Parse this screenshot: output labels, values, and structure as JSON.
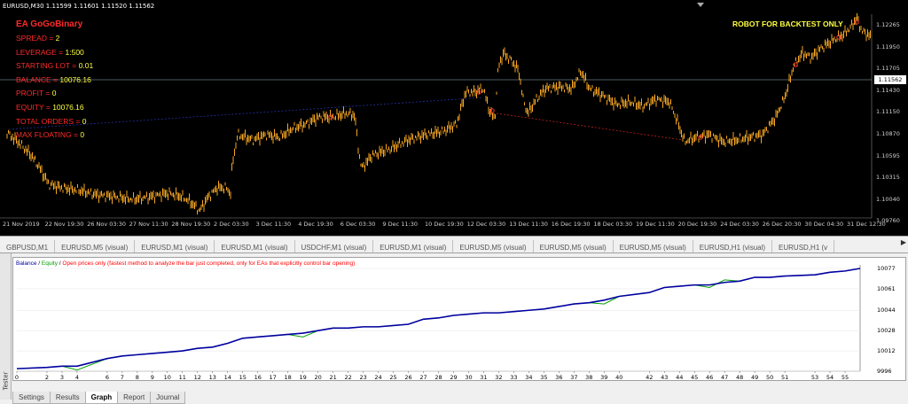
{
  "chart": {
    "title": "EURUSD,M30  1.11599 1.11601 1.11520 1.11562",
    "ea_name": "EA GoGoBinary",
    "stats": [
      {
        "label": "SPREAD = ",
        "value": "2"
      },
      {
        "label": "LEVERAGE = ",
        "value": "1:500"
      },
      {
        "label": "STARTING LOT = ",
        "value": "0.01"
      },
      {
        "label": "BALANCE = ",
        "value": "10076.16"
      },
      {
        "label": "PROFIT = ",
        "value": "0"
      },
      {
        "label": "EQUITY = ",
        "value": "10076.16"
      },
      {
        "label": "TOTAL ORDERS = ",
        "value": "0"
      },
      {
        "label": "MAX FLOATING = ",
        "value": "0"
      }
    ],
    "robot_label": "ROBOT FOR BACKTEST ONLY",
    "price_ticks": [
      "1.12265",
      "1.11950",
      "1.11705",
      "1.11430",
      "1.11150",
      "1.10870",
      "1.10595",
      "1.10315",
      "1.10040",
      "1.09760"
    ],
    "current_price": "1.11562",
    "time_ticks": [
      "21 Nov 2019",
      "22 Nov 19:30",
      "26 Nov 03:30",
      "27 Nov 11:30",
      "28 Nov 19:30",
      "2 Dec 03:30",
      "3 Dec 11:30",
      "4 Dec 19:30",
      "6 Dec 03:30",
      "9 Dec 11:30",
      "10 Dec 19:30",
      "12 Dec 03:30",
      "13 Dec 11:30",
      "16 Dec 19:30",
      "18 Dec 03:30",
      "19 Dec 11:30",
      "20 Dec 19:30",
      "24 Dec 03:30",
      "26 Dec 20:30",
      "30 Dec 04:30",
      "31 Dec 12:30"
    ],
    "colors": {
      "background": "#000000",
      "candle": "#f5a623",
      "label_red": "#ff2a2a",
      "label_yellow": "#ffff40"
    }
  },
  "chart_tabs": [
    "GBPUSD,M1",
    "EURUSD,M5 (visual)",
    "EURUSD,M1 (visual)",
    "EURUSD,M1 (visual)",
    "USDCHF,M1 (visual)",
    "EURUSD,M1 (visual)",
    "EURUSD,M5 (visual)",
    "EURUSD,M5 (visual)",
    "EURUSD,M5 (visual)",
    "EURUSD,H1 (visual)",
    "EURUSD,H1 (v"
  ],
  "tester": {
    "side_label": "Tester",
    "legend": {
      "balance": "Balance",
      "sep1": " / ",
      "equity": "Equity",
      "sep2": " / ",
      "mode": "Open prices only (fastest method to analyze the bar just completed, only for EAs that explicitly control bar opening)"
    },
    "tabs": [
      "Settings",
      "Results",
      "Graph",
      "Report",
      "Journal"
    ],
    "active_tab": "Graph",
    "colors": {
      "balance": "#0000a0",
      "equity": "#00a000",
      "mode": "#ff0000"
    }
  },
  "chart_data": {
    "type": "line",
    "ylim": [
      9996,
      10077
    ],
    "y_ticks": [
      "10077",
      "10061",
      "10044",
      "10028",
      "10012",
      "9996"
    ],
    "x_ticks": [
      "0",
      "2",
      "3",
      "4",
      "6",
      "7",
      "8",
      "9",
      "10",
      "11",
      "12",
      "13",
      "14",
      "15",
      "16",
      "17",
      "18",
      "19",
      "20",
      "21",
      "22",
      "23",
      "24",
      "25",
      "26",
      "27",
      "28",
      "29",
      "30",
      "31",
      "32",
      "33",
      "34",
      "35",
      "36",
      "37",
      "38",
      "39",
      "40",
      "42",
      "43",
      "44",
      "45",
      "46",
      "47",
      "48",
      "49",
      "50",
      "51",
      "53",
      "54",
      "55"
    ],
    "x": [
      0,
      2,
      3,
      4,
      6,
      7,
      8,
      9,
      10,
      11,
      12,
      13,
      14,
      15,
      16,
      17,
      18,
      19,
      20,
      21,
      22,
      23,
      24,
      25,
      26,
      27,
      28,
      29,
      30,
      31,
      32,
      33,
      34,
      35,
      36,
      37,
      38,
      39,
      40,
      42,
      43,
      44,
      45,
      46,
      47,
      48,
      49,
      50,
      51,
      53,
      54,
      55,
      56
    ],
    "series": [
      {
        "name": "Balance",
        "values": [
          9998,
          9999,
          10000,
          10000,
          10006,
          10008,
          10009,
          10010,
          10011,
          10012,
          10014,
          10015,
          10018,
          10022,
          10023,
          10024,
          10025,
          10026,
          10028,
          10030,
          10030,
          10031,
          10031,
          10032,
          10033,
          10037,
          10038,
          10040,
          10041,
          10042,
          10042,
          10043,
          10044,
          10045,
          10047,
          10049,
          10050,
          10052,
          10055,
          10058,
          10062,
          10063,
          10064,
          10064,
          10066,
          10067,
          10070,
          10070,
          10071,
          10072,
          10074,
          10075,
          10077
        ]
      },
      {
        "name": "Equity",
        "values": [
          9998,
          9999,
          10000,
          9997,
          10006,
          10008,
          10009,
          10010,
          10011,
          10012,
          10014,
          10015,
          10018,
          10022,
          10023,
          10024,
          10025,
          10023,
          10028,
          10030,
          10030,
          10031,
          10031,
          10032,
          10033,
          10037,
          10038,
          10040,
          10041,
          10042,
          10042,
          10043,
          10044,
          10045,
          10047,
          10049,
          10050,
          10049,
          10055,
          10058,
          10062,
          10063,
          10064,
          10062,
          10068,
          10067,
          10070,
          10070,
          10071,
          10072,
          10074,
          10075,
          10077
        ]
      }
    ]
  }
}
